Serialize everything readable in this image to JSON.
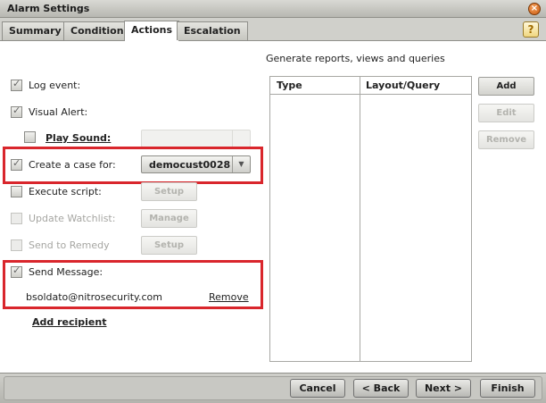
{
  "window": {
    "title": "Alarm Settings"
  },
  "tabs": [
    {
      "label": "Summary",
      "active": false
    },
    {
      "label": "Condition",
      "active": false
    },
    {
      "label": "Actions",
      "active": true
    },
    {
      "label": "Escalation",
      "active": false
    }
  ],
  "help_label": "?",
  "close_label": "×",
  "actions": {
    "log_event": {
      "label": "Log event:",
      "checked": true
    },
    "visual_alert": {
      "label": "Visual Alert:",
      "checked": true
    },
    "play_sound": {
      "label": "Play Sound:",
      "checked": false
    },
    "create_case": {
      "label": "Create a case for:",
      "checked": true,
      "value": "democust0028"
    },
    "execute_script": {
      "label": "Execute script:",
      "checked": false,
      "button": "Setup"
    },
    "update_watchlist": {
      "label": "Update Watchlist:",
      "checked": false,
      "button": "Manage"
    },
    "send_remedy": {
      "label": "Send to Remedy",
      "checked": false,
      "button": "Setup"
    },
    "send_message": {
      "label": "Send Message:",
      "checked": true
    },
    "recipient": {
      "email": "bsoldato@nitrosecurity.com",
      "remove_label": "Remove"
    },
    "add_recipient_label": "Add recipient"
  },
  "reports": {
    "title": "Generate reports, views and queries",
    "columns": [
      "Type",
      "Layout/Query"
    ],
    "rows": [],
    "buttons": {
      "add": "Add",
      "edit": "Edit",
      "remove": "Remove"
    }
  },
  "footer": {
    "cancel": "Cancel",
    "back": "< Back",
    "next": "Next >",
    "finish": "Finish"
  },
  "colors": {
    "highlight": "#d9262c"
  }
}
